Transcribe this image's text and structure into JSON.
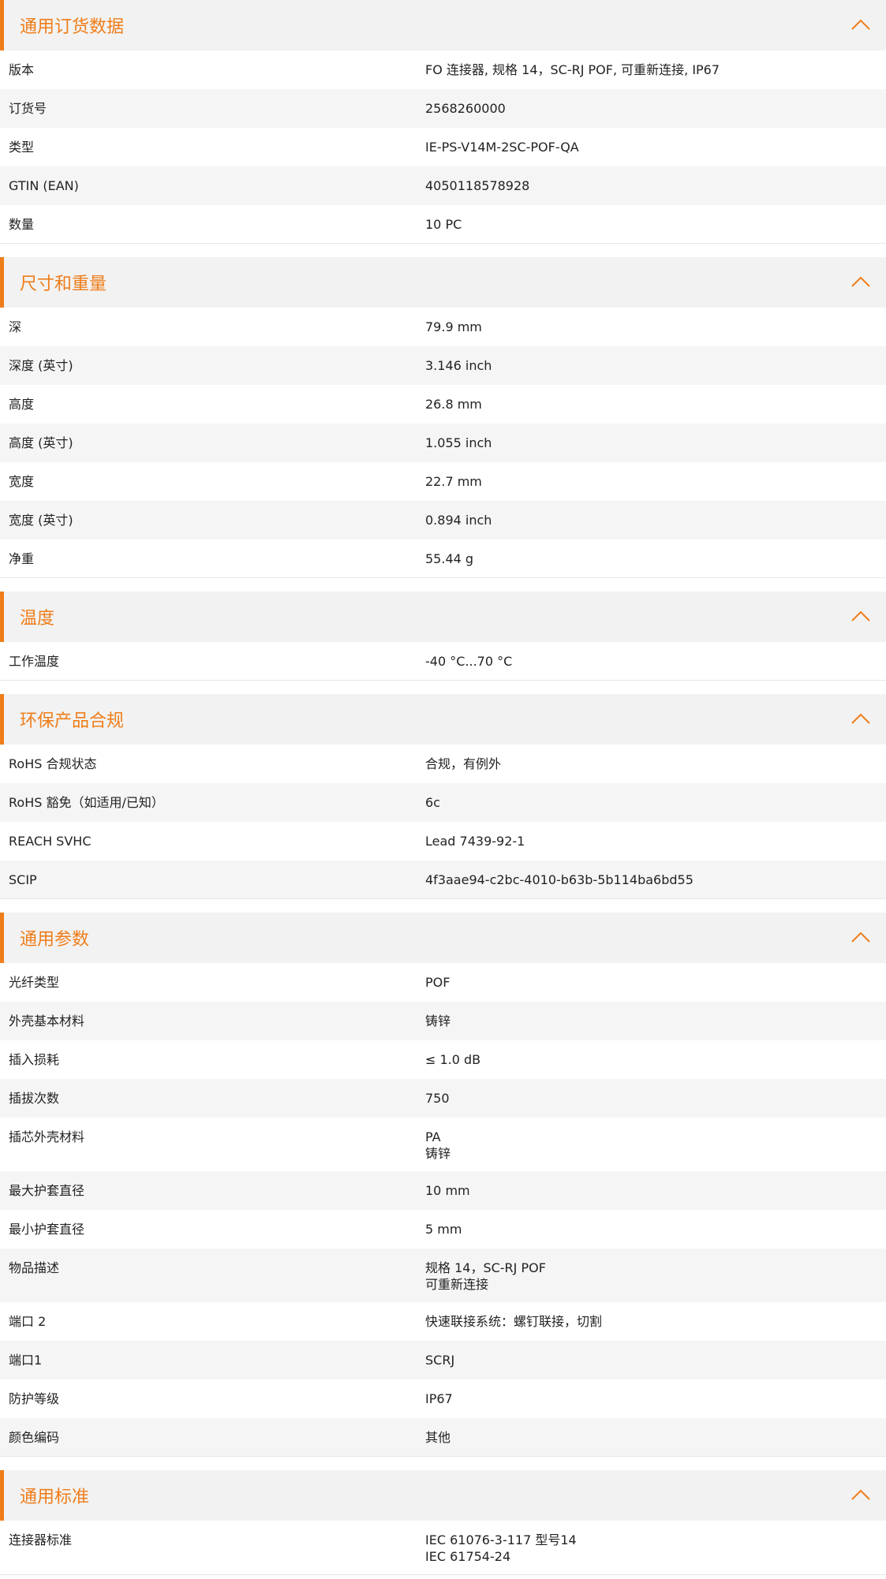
{
  "accent": "#ef7d1a",
  "sections": [
    {
      "title": "通用订货数据",
      "icon": "chevron-up-icon",
      "rows": [
        {
          "label": "版本",
          "value": [
            "FO 连接器, 规格 14，SC-RJ POF, 可重新连接, IP67"
          ]
        },
        {
          "label": "订货号",
          "value": [
            "2568260000"
          ]
        },
        {
          "label": "类型",
          "value": [
            "IE-PS-V14M-2SC-POF-QA"
          ]
        },
        {
          "label": "GTIN (EAN)",
          "value": [
            "4050118578928"
          ]
        },
        {
          "label": "数量",
          "value": [
            "10  PC"
          ]
        }
      ]
    },
    {
      "title": "尺寸和重量",
      "icon": "chevron-up-icon",
      "rows": [
        {
          "label": "深",
          "value": [
            "79.9  mm"
          ]
        },
        {
          "label": "深度 (英寸)",
          "value": [
            "3.146  inch"
          ]
        },
        {
          "label": "高度",
          "value": [
            "26.8  mm"
          ]
        },
        {
          "label": "高度 (英寸)",
          "value": [
            "1.055  inch"
          ]
        },
        {
          "label": "宽度",
          "value": [
            "22.7  mm"
          ]
        },
        {
          "label": "宽度 (英寸)",
          "value": [
            "0.894  inch"
          ]
        },
        {
          "label": "净重",
          "value": [
            "55.44  g"
          ]
        }
      ]
    },
    {
      "title": "温度",
      "icon": "chevron-up-icon",
      "rows": [
        {
          "label": "工作温度",
          "value": [
            "-40 °C...70 °C"
          ]
        }
      ]
    },
    {
      "title": "环保产品合规",
      "icon": "chevron-up-icon",
      "rows": [
        {
          "label": "RoHS 合规状态",
          "value": [
            "合规，有例外"
          ]
        },
        {
          "label": "RoHS 豁免（如适用/已知）",
          "value": [
            "6c"
          ]
        },
        {
          "label": "REACH SVHC",
          "value": [
            "Lead 7439-92-1"
          ]
        },
        {
          "label": "SCIP",
          "value": [
            "4f3aae94-c2bc-4010-b63b-5b114ba6bd55"
          ]
        }
      ]
    },
    {
      "title": "通用参数",
      "icon": "chevron-up-icon",
      "rows": [
        {
          "label": "光纤类型",
          "value": [
            "POF"
          ]
        },
        {
          "label": "外壳基本材料",
          "value": [
            "铸锌"
          ]
        },
        {
          "label": "插入损耗",
          "value": [
            "≤ 1.0 dB"
          ]
        },
        {
          "label": "插拔次数",
          "value": [
            "750"
          ]
        },
        {
          "label": "插芯外壳材料",
          "value": [
            "PA",
            "铸锌"
          ]
        },
        {
          "label": "最大护套直径",
          "value": [
            "10  mm"
          ]
        },
        {
          "label": "最小护套直径",
          "value": [
            "5  mm"
          ]
        },
        {
          "label": "物品描述",
          "value": [
            "规格 14，SC-RJ POF",
            "可重新连接"
          ]
        },
        {
          "label": "端口 2",
          "value": [
            "快速联接系统：螺钉联接，切割"
          ]
        },
        {
          "label": "端口1",
          "value": [
            "SCRJ"
          ]
        },
        {
          "label": "防护等级",
          "value": [
            "IP67"
          ]
        },
        {
          "label": "颜色编码",
          "value": [
            "其他"
          ]
        }
      ]
    },
    {
      "title": "通用标准",
      "icon": "chevron-up-icon",
      "rows": [
        {
          "label": "连接器标准",
          "value": [
            "IEC 61076-3-117 型号14",
            "IEC 61754-24"
          ]
        }
      ]
    }
  ]
}
